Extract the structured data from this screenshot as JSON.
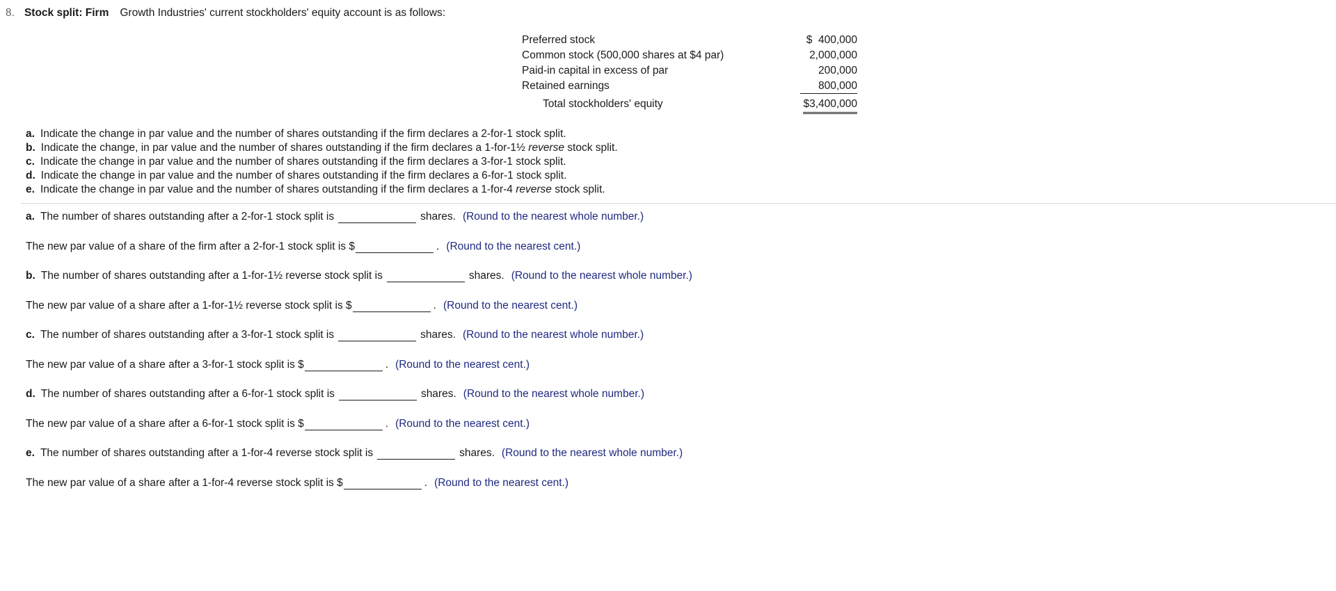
{
  "question": {
    "number": "8.",
    "title": "Stock split: Firm",
    "intro": "Growth Industries' current stockholders' equity account is as follows:"
  },
  "equity": {
    "rows": [
      {
        "label": "Preferred stock",
        "amount": "$  400,000"
      },
      {
        "label": "Common stock (500,000 shares at $4 par)",
        "amount": "2,000,000"
      },
      {
        "label": "Paid-in capital in excess of par",
        "amount": "200,000"
      },
      {
        "label": "Retained earnings",
        "amount": "800,000"
      }
    ],
    "total": {
      "label": "Total stockholders' equity",
      "amount": "$3,400,000"
    }
  },
  "parts": [
    {
      "letter": "a.",
      "pre": "Indicate the change in par value and the number of shares outstanding if the firm declares a 2-for-1 stock split.",
      "em": "",
      "post": ""
    },
    {
      "letter": "b.",
      "pre": "Indicate the change, in par value and the number of shares outstanding if the firm declares a 1-for-1½ ",
      "em": "reverse",
      "post": " stock split."
    },
    {
      "letter": "c.",
      "pre": "Indicate the change in par value and the number of shares outstanding if the firm declares a 3-for-1 stock split.",
      "em": "",
      "post": ""
    },
    {
      "letter": "d.",
      "pre": "Indicate the change in par value and the number of shares outstanding if the firm declares a 6-for-1 stock split.",
      "em": "",
      "post": ""
    },
    {
      "letter": "e.",
      "pre": "Indicate the change in par value and the number of shares outstanding if the firm declares a 1-for-4 ",
      "em": "reverse",
      "post": " stock split."
    }
  ],
  "answers": {
    "shares_unit": "shares.",
    "period": ".",
    "hint_shares": "(Round to the nearest whole number.)",
    "hint_cents": "(Round to the nearest cent.)",
    "rows": [
      {
        "letter": "a.",
        "text": "The number of shares outstanding after a 2-for-1 stock split is",
        "value": ""
      },
      {
        "letter": "",
        "text": "The new par value of a share of the firm after a 2-for-1 stock split is $",
        "value": ""
      },
      {
        "letter": "b.",
        "text": "The number of shares outstanding after a 1-for-1½ reverse stock split is",
        "value": ""
      },
      {
        "letter": "",
        "text": "The new par value of a share after a 1-for-1½ reverse stock split is $",
        "value": ""
      },
      {
        "letter": "c.",
        "text": "The number of shares outstanding after a 3-for-1 stock split is",
        "value": ""
      },
      {
        "letter": "",
        "text": "The new par value of a share after a 3-for-1 stock split is $",
        "value": ""
      },
      {
        "letter": "d.",
        "text": "The number of shares outstanding after a 6-for-1 stock split is",
        "value": ""
      },
      {
        "letter": "",
        "text": "The new par value of a share after a 6-for-1 stock split is $",
        "value": ""
      },
      {
        "letter": "e.",
        "text": "The number of shares outstanding after a 1-for-4 reverse stock split is",
        "value": ""
      },
      {
        "letter": "",
        "text": "The new par value of a share after a 1-for-4 reverse stock split is $",
        "value": ""
      }
    ]
  },
  "colors": {
    "hint": "#1f2a80",
    "number": "#666666",
    "divider": "#d9d9d9"
  }
}
